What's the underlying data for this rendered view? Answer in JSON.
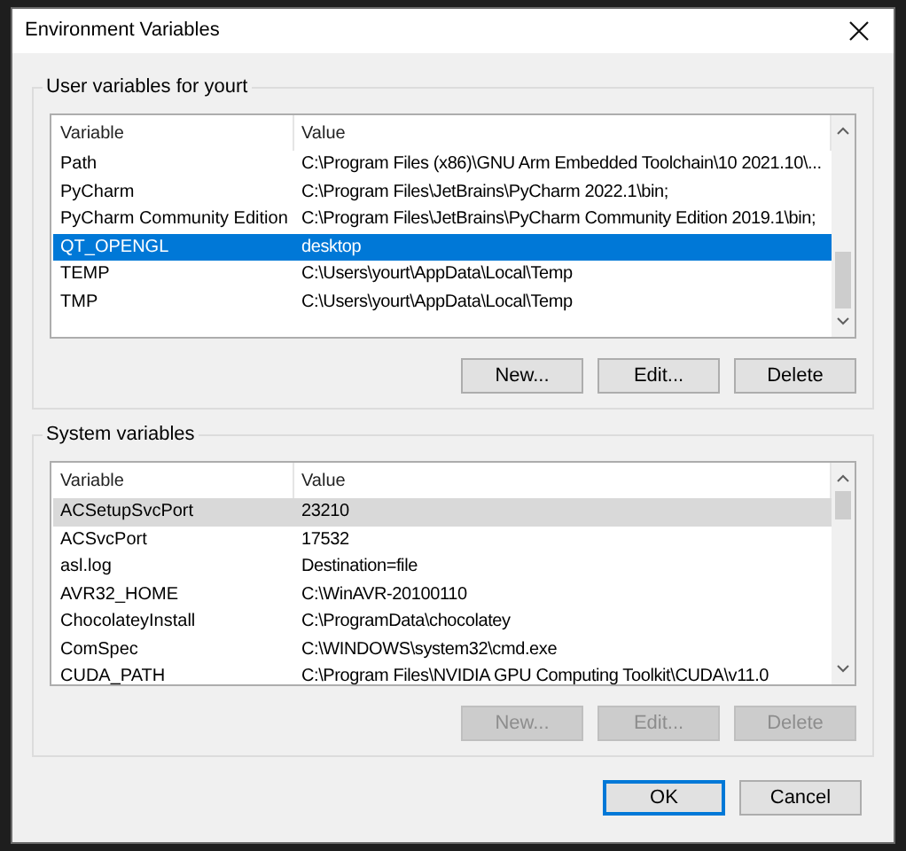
{
  "window": {
    "title": "Environment Variables"
  },
  "groups": [
    {
      "title": "User variables for yourt",
      "focused": true,
      "columns": [
        "Variable",
        "Value"
      ],
      "rows": [
        {
          "variable": "Path",
          "value": "C:\\Program Files (x86)\\GNU Arm Embedded Toolchain\\10 2021.10\\...",
          "selected": false
        },
        {
          "variable": "PyCharm",
          "value": "C:\\Program Files\\JetBrains\\PyCharm 2022.1\\bin;",
          "selected": false
        },
        {
          "variable": "PyCharm Community Edition",
          "value": "C:\\Program Files\\JetBrains\\PyCharm Community Edition 2019.1\\bin;",
          "selected": false
        },
        {
          "variable": "QT_OPENGL",
          "value": "desktop",
          "selected": true
        },
        {
          "variable": "TEMP",
          "value": "C:\\Users\\yourt\\AppData\\Local\\Temp",
          "selected": false
        },
        {
          "variable": "TMP",
          "value": "C:\\Users\\yourt\\AppData\\Local\\Temp",
          "selected": false
        }
      ],
      "buttons": [
        {
          "label": "New...",
          "disabled": false
        },
        {
          "label": "Edit...",
          "disabled": false
        },
        {
          "label": "Delete",
          "disabled": false
        }
      ]
    },
    {
      "title": "System variables",
      "focused": false,
      "columns": [
        "Variable",
        "Value"
      ],
      "rows": [
        {
          "variable": "ACSetupSvcPort",
          "value": "23210",
          "selected": true
        },
        {
          "variable": "ACSvcPort",
          "value": "17532",
          "selected": false
        },
        {
          "variable": "asl.log",
          "value": "Destination=file",
          "selected": false
        },
        {
          "variable": "AVR32_HOME",
          "value": "C:\\WinAVR-20100110",
          "selected": false
        },
        {
          "variable": "ChocolateyInstall",
          "value": "C:\\ProgramData\\chocolatey",
          "selected": false
        },
        {
          "variable": "ComSpec",
          "value": "C:\\WINDOWS\\system32\\cmd.exe",
          "selected": false
        },
        {
          "variable": "CUDA_PATH",
          "value": "C:\\Program Files\\NVIDIA GPU Computing Toolkit\\CUDA\\v11.0",
          "selected": false
        }
      ],
      "buttons": [
        {
          "label": "New...",
          "disabled": true
        },
        {
          "label": "Edit...",
          "disabled": true
        },
        {
          "label": "Delete",
          "disabled": true
        }
      ]
    }
  ],
  "footer_buttons": [
    {
      "label": "OK",
      "default": true
    },
    {
      "label": "Cancel",
      "default": false
    }
  ]
}
